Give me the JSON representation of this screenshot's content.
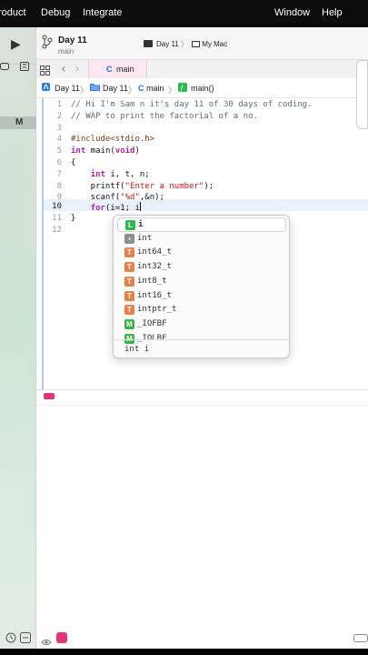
{
  "menubar": {
    "items": [
      "roduct",
      "Debug",
      "Integrate"
    ],
    "right_items": [
      "Window",
      "Help"
    ]
  },
  "sidebar": {
    "badge": "M"
  },
  "toolbar": {
    "project": "Day 11",
    "branch": "main",
    "scheme": "Day 11",
    "separator": "〉",
    "destination": "My Mac"
  },
  "tab": {
    "label": "main",
    "icon_glyph": "C"
  },
  "jumpbar": {
    "items": [
      "Day 11",
      "Day 11",
      "main",
      "main()"
    ],
    "separator": "〉"
  },
  "editor": {
    "current_line": 10,
    "lines": [
      {
        "number": "1",
        "text": "// Hi I'm Sam n it's day 11 of 30 days of coding."
      },
      {
        "number": "2",
        "text": "// WAP to print the factorial of a no."
      },
      {
        "number": "3",
        "text": ""
      },
      {
        "number": "4",
        "text": "#include<stdio.h>"
      },
      {
        "number": "5",
        "text": "int main(void)"
      },
      {
        "number": "6",
        "text": "{"
      },
      {
        "number": "7",
        "text": "    int i, t, n;"
      },
      {
        "number": "8",
        "text": "    printf(\"Enter a number\");"
      },
      {
        "number": "9",
        "text": "    scanf(\"%d\",&n);"
      },
      {
        "number": "10",
        "text": "    for(i=1; i"
      },
      {
        "number": "11",
        "text": "}"
      },
      {
        "number": "12",
        "text": ""
      }
    ]
  },
  "autocomplete": {
    "items": [
      {
        "badge": "L",
        "label": "i",
        "color": "#2db84d",
        "selected": true
      },
      {
        "badge": "▪",
        "label": "int",
        "color": "#8e8e93",
        "selected": false
      },
      {
        "badge": "T",
        "label": "int64_t",
        "color": "#e8804a",
        "selected": false
      },
      {
        "badge": "T",
        "label": "int32_t",
        "color": "#e8804a",
        "selected": false
      },
      {
        "badge": "T",
        "label": "int8_t",
        "color": "#e8804a",
        "selected": false
      },
      {
        "badge": "T",
        "label": "int16_t",
        "color": "#e8804a",
        "selected": false
      },
      {
        "badge": "T",
        "label": "intptr_t",
        "color": "#e8804a",
        "selected": false
      },
      {
        "badge": "M",
        "label": "_IOFBF",
        "color": "#3bb54a",
        "selected": false
      },
      {
        "badge": "M",
        "label": "_IOLBF",
        "color": "#3bb54a",
        "selected": false
      }
    ],
    "detail": "int i"
  },
  "colors": {
    "accent": "#1a73e8",
    "current_line_bg": "#e9f1fb",
    "tab_bg": "#fde7f0",
    "debug_marker": "#e2357a"
  },
  "icons": [
    "play-icon",
    "branch-icon",
    "grid-icon",
    "back-icon",
    "forward-icon",
    "swift-file-icon",
    "app-icon",
    "function-icon",
    "eye-icon",
    "clock-icon"
  ]
}
